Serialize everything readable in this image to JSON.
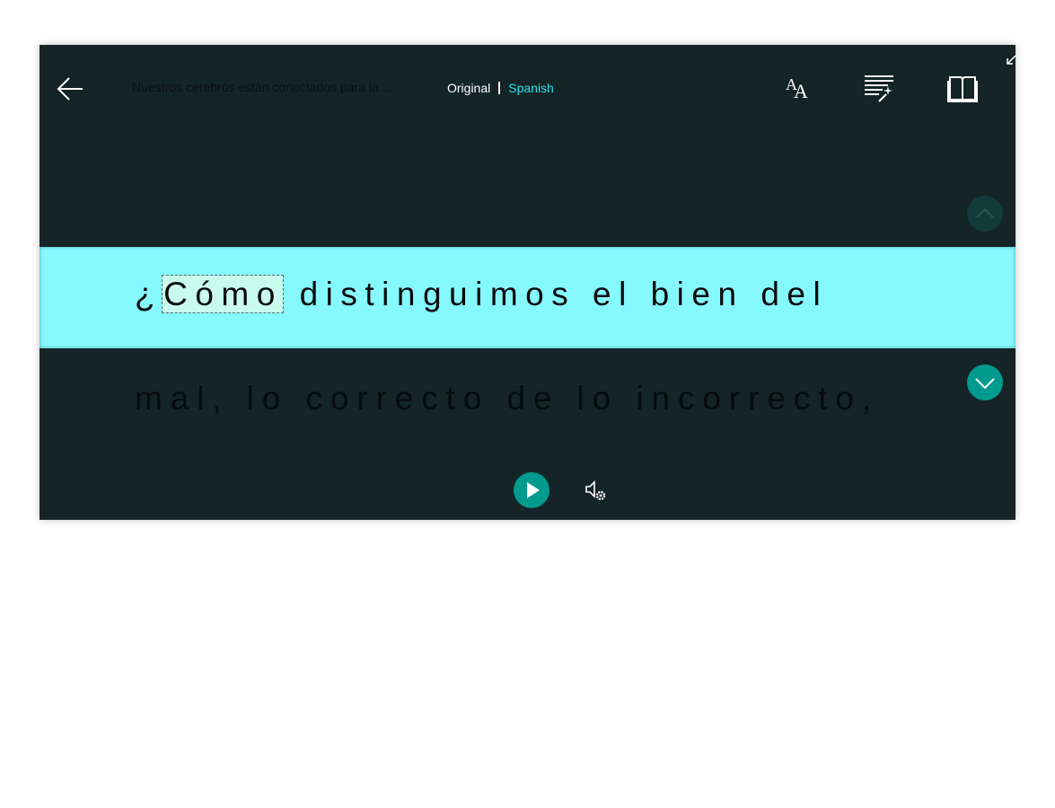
{
  "header": {
    "back_icon": "arrow-left-icon",
    "title": "Nuestros cerebros están conectados para la ...",
    "language_toggle": {
      "original": "Original",
      "translated": "Spanish",
      "active": "Spanish"
    },
    "tools": [
      {
        "name": "text-preferences",
        "icon": "font-size-icon"
      },
      {
        "name": "grammar-options",
        "icon": "lines-wand-icon"
      },
      {
        "name": "reading-preferences",
        "icon": "open-book-icon"
      }
    ],
    "collapse_icon": "arrow-collapse-icon"
  },
  "content": {
    "current_line_prefix": "¿",
    "current_word": "Cómo",
    "current_line_rest": " distinguimos el bien del",
    "next_line": "mal, lo correcto de lo incorrecto,"
  },
  "controls": {
    "scroll_up_icon": "chevron-up-icon",
    "scroll_down_icon": "chevron-down-icon",
    "play_icon": "play-icon",
    "voice_settings_icon": "speaker-gear-icon"
  },
  "colors": {
    "background": "#152426",
    "highlight_band": "#85f9fe",
    "word_highlight": "#c8fbed",
    "accent": "#009a8f",
    "active_language": "#26e4ea"
  }
}
